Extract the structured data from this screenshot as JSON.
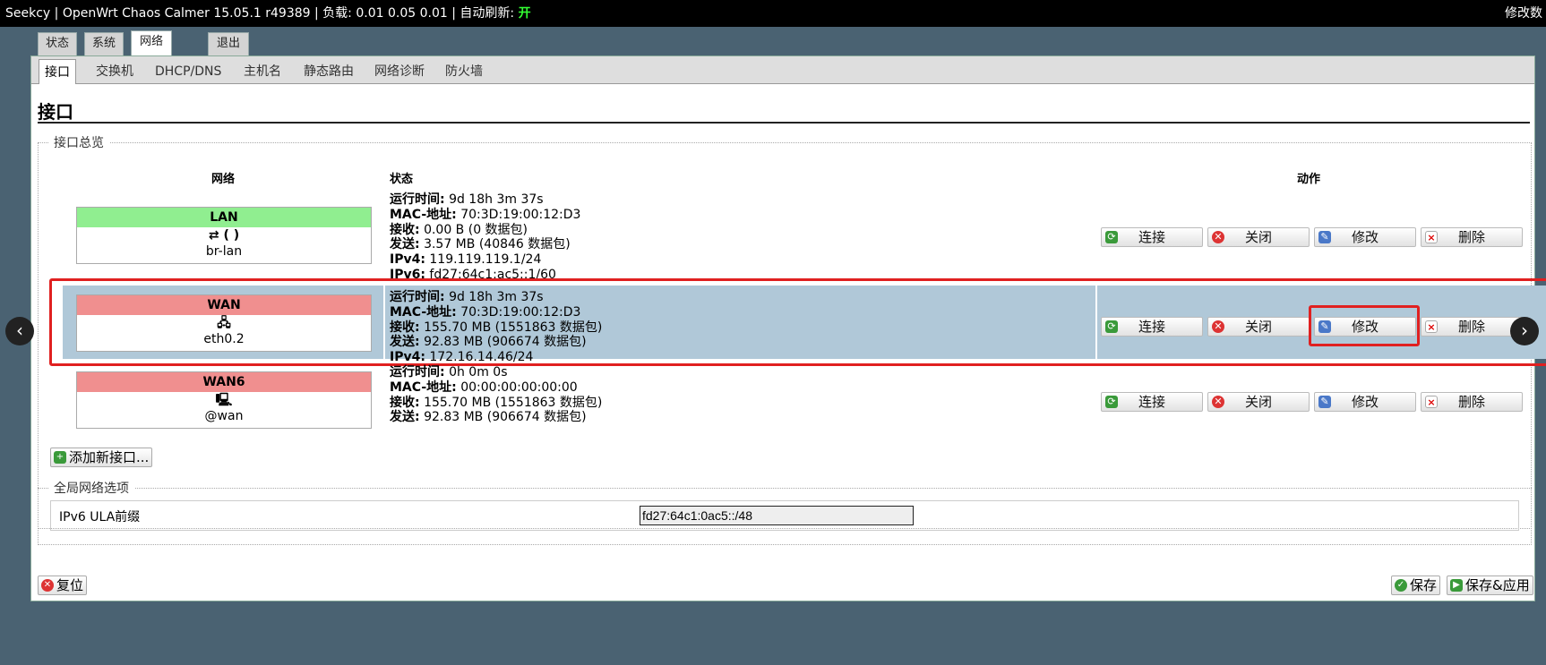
{
  "header": {
    "host": "Seekcy",
    "firmware": "OpenWrt Chaos Calmer 15.05.1 r49389",
    "load_label": "负载:",
    "load_values": "0.01 0.05 0.01",
    "autorefresh_label": "自动刷新:",
    "autorefresh_state": "开",
    "right_text": "修改数"
  },
  "main_tabs": [
    "状态",
    "系统",
    "网络",
    "退出"
  ],
  "sub_tabs": [
    "接口",
    "交换机",
    "DHCP/DNS",
    "主机名",
    "静态路由",
    "网络诊断",
    "防火墙"
  ],
  "page_title": "接口",
  "overview": {
    "legend": "接口总览",
    "col_network": "网络",
    "col_status": "状态",
    "col_actions": "动作",
    "rows": [
      {
        "name": "LAN",
        "color": "#90ee90",
        "icons_text": "(  )",
        "device": "br-lan",
        "uptime_label": "运行时间:",
        "uptime": "9d 18h 3m 37s",
        "mac_label": "MAC-地址:",
        "mac": "70:3D:19:00:12:D3",
        "rx_label": "接收:",
        "rx": "0.00 B (0 数据包)",
        "tx_label": "发送:",
        "tx": "3.57 MB (40846 数据包)",
        "ipv4_label": "IPv4:",
        "ipv4": "119.119.119.1/24",
        "ipv6_label": "IPv6:",
        "ipv6": "fd27:64c1:ac5::1/60"
      },
      {
        "name": "WAN",
        "color": "#f08f8f",
        "device": "eth0.2",
        "uptime_label": "运行时间:",
        "uptime": "9d 18h 3m 37s",
        "mac_label": "MAC-地址:",
        "mac": "70:3D:19:00:12:D3",
        "rx_label": "接收:",
        "rx": "155.70 MB (1551863 数据包)",
        "tx_label": "发送:",
        "tx": "92.83 MB (906674 数据包)",
        "ipv4_label": "IPv4:",
        "ipv4": "172.16.14.46/24"
      },
      {
        "name": "WAN6",
        "color": "#f08f8f",
        "device": "@wan",
        "uptime_label": "运行时间:",
        "uptime": "0h 0m 0s",
        "mac_label": "MAC-地址:",
        "mac": "00:00:00:00:00:00",
        "rx_label": "接收:",
        "rx": "155.70 MB (1551863 数据包)",
        "tx_label": "发送:",
        "tx": "92.83 MB (906674 数据包)"
      }
    ],
    "actions": {
      "connect": "连接",
      "close": "关闭",
      "edit": "修改",
      "delete": "删除"
    },
    "add_button": "添加新接口..."
  },
  "global": {
    "legend": "全局网络选项",
    "ula_label": "IPv6 ULA前缀",
    "ula_value": "fd27:64c1:0ac5::/48"
  },
  "footer": {
    "reset": "复位",
    "save": "保存",
    "save_apply": "保存&应用"
  }
}
